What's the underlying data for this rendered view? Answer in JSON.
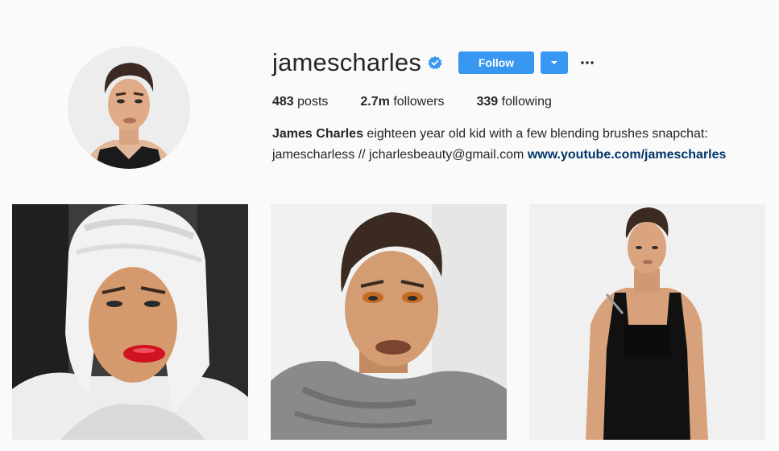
{
  "profile": {
    "username": "jamescharles",
    "verified": true,
    "follow_label": "Follow",
    "dropdown_glyph": "▾",
    "more_glyph": "···"
  },
  "stats": {
    "posts_count": "483",
    "posts_label": "posts",
    "followers_count": "2.7m",
    "followers_label": "followers",
    "following_count": "339",
    "following_label": "following"
  },
  "bio": {
    "name": "James Charles",
    "text": "eighteen year old kid with a few blending brushes snapchat: jamescharless // jcharlesbeauty@gmail.com",
    "link": "www.youtube.com/jamescharles"
  },
  "posts": [
    {
      "description_icon": "photo-towel-red-lips"
    },
    {
      "description_icon": "photo-orange-eyeshadow-turtleneck"
    },
    {
      "description_icon": "photo-black-overalls"
    }
  ],
  "colors": {
    "background": "#fafafa",
    "accent": "#3897f0",
    "link": "#003569",
    "text": "#262626"
  }
}
